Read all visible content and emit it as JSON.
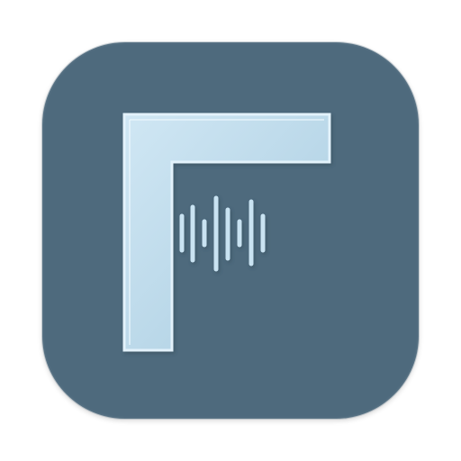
{
  "icon": {
    "name": "app-icon",
    "colors": {
      "background": "#4e6a7d",
      "glyph_fill": "#b9d8ea",
      "glyph_edge": "#dcefff",
      "glyph_shadow": "#2f4757"
    },
    "glyph": "letter-f-with-audio-waveform",
    "waveform": "audio-waveform-icon"
  }
}
